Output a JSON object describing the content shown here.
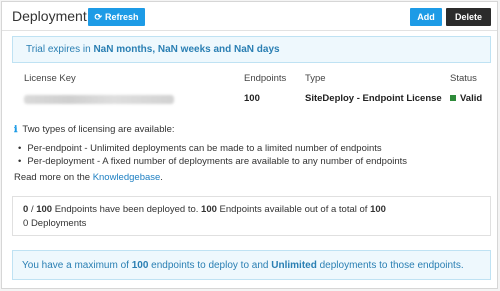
{
  "header": {
    "title": "Deployment",
    "refresh_label": "Refresh",
    "add_label": "Add",
    "delete_label": "Delete"
  },
  "trial": {
    "prefix": "Trial expires in",
    "value": "NaN months, NaN weeks and NaN days"
  },
  "license_table": {
    "columns": [
      "License Key",
      "Endpoints",
      "Type",
      "Status"
    ],
    "row": {
      "endpoints": "100",
      "type": "SiteDeploy - Endpoint License",
      "status": "Valid",
      "status_color": "#2e8b3a"
    }
  },
  "licensing_info": {
    "intro": "Two types of licensing are available:",
    "items": [
      "Per-endpoint - Unlimited deployments can be made to a limited number of endpoints",
      "Per-deployment - A fixed number of deployments are available to any number of endpoints"
    ],
    "read_more_prefix": "Read more on the",
    "link_text": "Knowledgebase",
    "read_more_suffix": "."
  },
  "summary": {
    "deployed": "0",
    "deployed_sep": "/",
    "total_a": "100",
    "text_mid": "Endpoints have been deployed to.",
    "available": "100",
    "text_avail": "Endpoints available out of a total of",
    "total_b": "100",
    "deployments_count": "0",
    "deployments_label": "Deployments"
  },
  "maximum": {
    "prefix": "You have a maximum of",
    "endpoints": "100",
    "mid": "endpoints to deploy to and",
    "deployments": "Unlimited",
    "suffix": "deployments to those endpoints."
  },
  "colors": {
    "primary": "#1d9be6",
    "dark_button": "#2b2b2b",
    "info_bg": "#eef8fd",
    "info_text": "#2a7fb3"
  }
}
